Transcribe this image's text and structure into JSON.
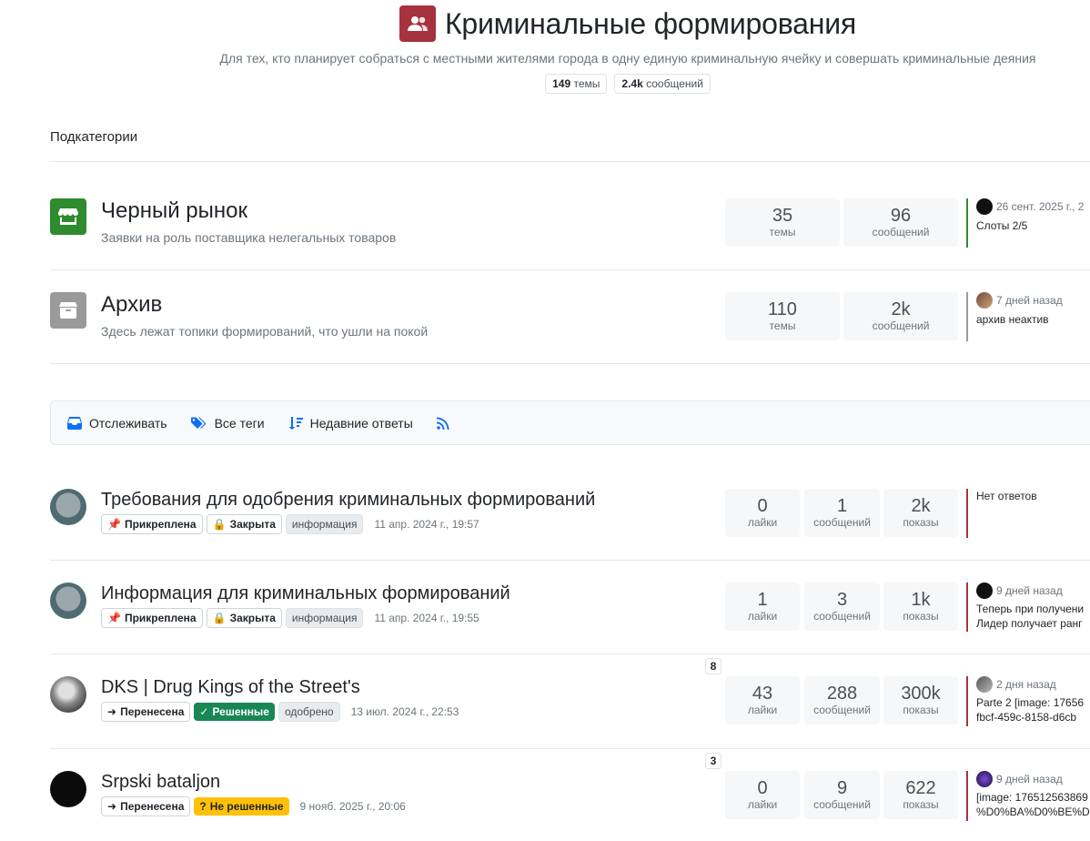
{
  "category": {
    "title": "Криминальные формирования",
    "icon": "users-icon",
    "accent": "#a6323d",
    "description": "Для тех, кто планирует собраться с местными жителями города в одну единую криминальную ячейку и совершать криминальные деяния",
    "topics_count": "149",
    "topics_label": "темы",
    "posts_count": "2.4k",
    "posts_label": "сообщений"
  },
  "subcategories_heading": "Подкатегории",
  "subcategories": [
    {
      "title": "Черный рынок",
      "description": "Заявки на роль поставщика нелегальных товаров",
      "icon": "store-icon",
      "color": "#2e8b2e",
      "topics": "35",
      "topics_label": "темы",
      "posts": "96",
      "posts_label": "сообщений",
      "last_time": "26 сент. 2025 г., 2",
      "last_text": "Слоты 2/5",
      "border": "#2e8b2e"
    },
    {
      "title": "Архив",
      "description": "Здесь лежат топики формирований, что ушли на покой",
      "icon": "box-icon",
      "color": "#9a9a9a",
      "topics": "110",
      "topics_label": "темы",
      "posts": "2k",
      "posts_label": "сообщений",
      "last_time": "7 дней назад",
      "last_text": "архив неактив",
      "border": "#9a9a9a"
    }
  ],
  "toolbar": {
    "watch": "Отслеживать",
    "tags": "Все теги",
    "recent": "Недавние ответы",
    "accent": "#0d6efd"
  },
  "topics": [
    {
      "title": "Требования для одобрения криминальных формирований",
      "tags": [
        "Прикреплена",
        "Закрыта",
        "информация"
      ],
      "date": "11 апр. 2024 г., 19:57",
      "likes": "0",
      "posts": "1",
      "views": "2k",
      "likes_label": "лайки",
      "posts_label": "сообщений",
      "views_label": "показы",
      "last_line1": "Нет ответов",
      "last_line2": "",
      "border": "#a6323d"
    },
    {
      "title": "Информация для криминальных формирований",
      "tags": [
        "Прикреплена",
        "Закрыта",
        "информация"
      ],
      "date": "11 апр. 2024 г., 19:55",
      "likes": "1",
      "posts": "3",
      "views": "1k",
      "likes_label": "лайки",
      "posts_label": "сообщений",
      "views_label": "показы",
      "last_time": "9 дней назад",
      "last_line1": "Теперь при получени",
      "last_line2": "Лидер получает ранг",
      "border": "#a6323d"
    },
    {
      "title": "DKS | Drug Kings of the Street's",
      "tags": [
        "Перенесена",
        "Решенные",
        "одобрено"
      ],
      "date": "13 июл. 2024 г., 22:53",
      "pages": "8",
      "likes": "43",
      "posts": "288",
      "views": "300k",
      "likes_label": "лайки",
      "posts_label": "сообщений",
      "views_label": "показы",
      "last_time": "2 дня назад",
      "last_line1": "Parte 2 [image: 17656",
      "last_line2": "fbcf-459c-8158-d6cb",
      "border": "#a6323d"
    },
    {
      "title": "Srpski bataljon",
      "tags": [
        "Перенесена",
        "Не решенные"
      ],
      "date": "9 нояб. 2025 г., 20:06",
      "pages": "3",
      "likes": "0",
      "posts": "9",
      "views": "622",
      "likes_label": "лайки",
      "posts_label": "сообщений",
      "views_label": "показы",
      "last_time": "9 дней назад",
      "last_line1": "[image: 176512563869",
      "last_line2": "%D0%BA%D0%BE%D",
      "border": "#a6323d"
    }
  ]
}
